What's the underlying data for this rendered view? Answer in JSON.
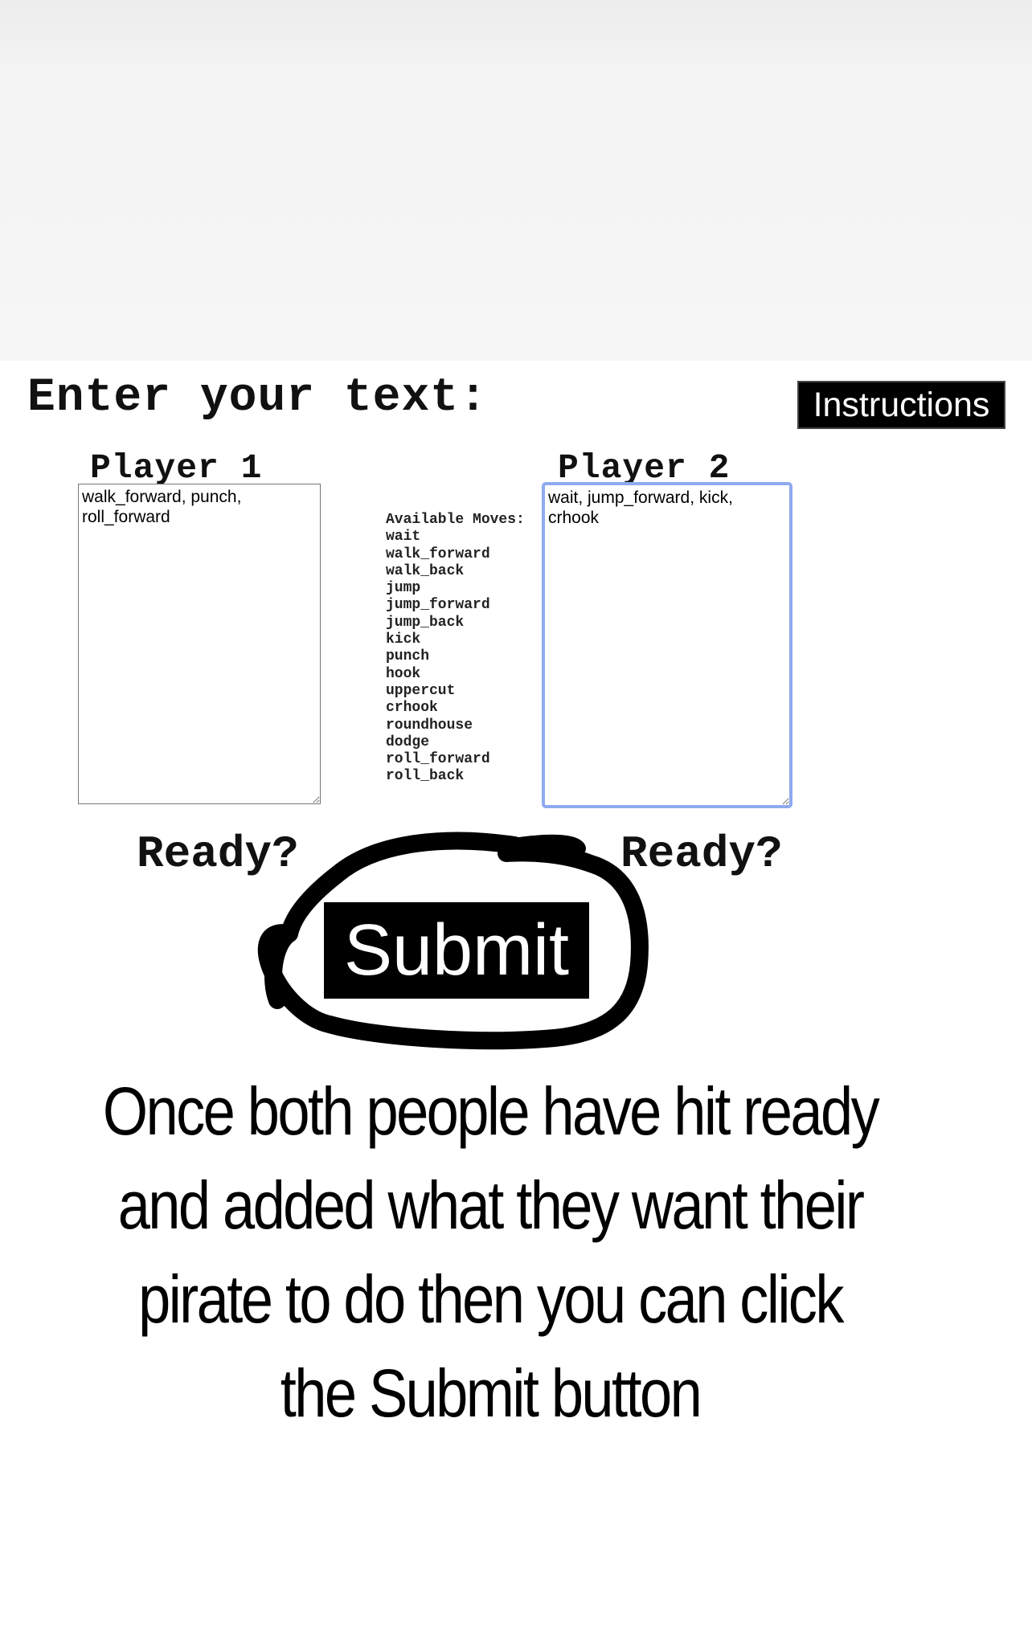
{
  "header": {
    "title": "Enter your text:",
    "instructions_label": "Instructions"
  },
  "player1": {
    "label": "Player 1",
    "moves_value": "walk_forward, punch, roll_forward",
    "ready_label": "Ready?"
  },
  "player2": {
    "label": "Player 2",
    "moves_value": "wait, jump_forward, kick, crhook",
    "ready_label": "Ready?"
  },
  "available_moves": {
    "heading": "Available Moves:",
    "items": [
      "wait",
      "walk_forward",
      "walk_back",
      "jump",
      "jump_forward",
      "jump_back",
      "kick",
      "punch",
      "hook",
      "uppercut",
      "crhook",
      "roundhouse",
      "dodge",
      "roll_forward",
      "roll_back"
    ]
  },
  "submit": {
    "label": "Submit"
  },
  "annotation": {
    "caption": "Once both people have hit ready and added what they want their pirate to do then you can click the Submit button"
  }
}
